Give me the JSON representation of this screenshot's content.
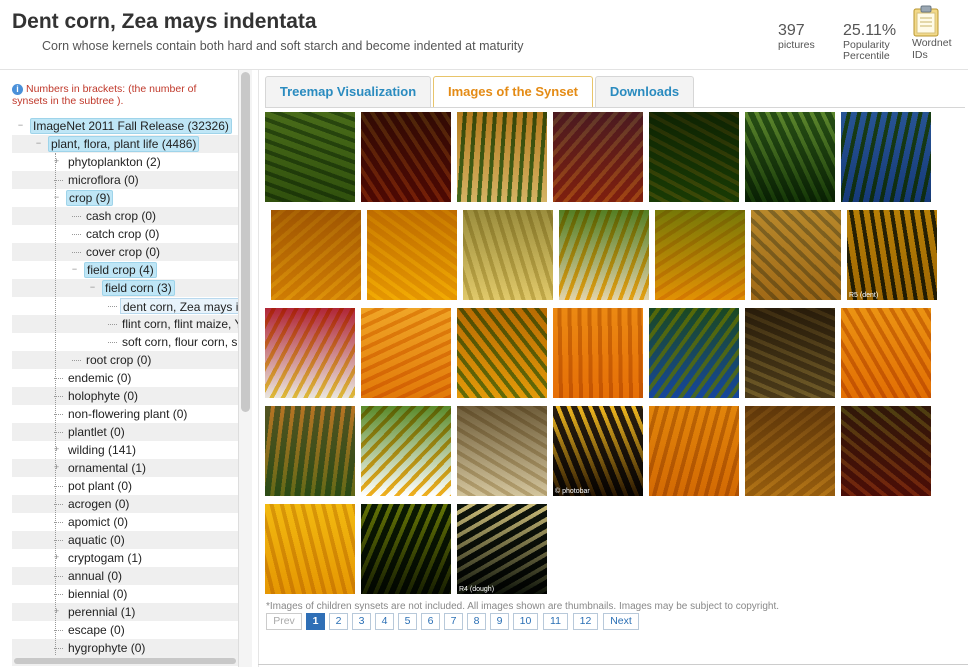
{
  "header": {
    "title": "Dent corn, Zea mays indentata",
    "subtitle": "Corn whose kernels contain both hard and soft starch and become indented at maturity",
    "pictures_count": "397",
    "pictures_label": "pictures",
    "popularity_value": "25.11%",
    "popularity_label_1": "Popularity",
    "popularity_label_2": "Percentile",
    "wordnet_label_1": "Wordnet",
    "wordnet_label_2": "IDs",
    "wordnet_icon": "clipboard-icon"
  },
  "sidebar": {
    "note": "Numbers in brackets: (the number of synsets in the subtree ).",
    "info_icon": "info-icon",
    "tree": [
      {
        "label": "ImageNet 2011 Fall Release (32326)",
        "state": "selected"
      },
      {
        "label": "plant, flora, plant life (4486)",
        "state": "selected"
      },
      {
        "label": "phytoplankton (2)",
        "state": ""
      },
      {
        "label": "microflora (0)",
        "state": ""
      },
      {
        "label": "crop (9)",
        "state": "selected"
      },
      {
        "label": "cash crop (0)",
        "state": ""
      },
      {
        "label": "catch crop (0)",
        "state": ""
      },
      {
        "label": "cover crop (0)",
        "state": ""
      },
      {
        "label": "field crop (4)",
        "state": "selected"
      },
      {
        "label": "field corn (3)",
        "state": "selected"
      },
      {
        "label": "dent corn, Zea mays i",
        "state": "current"
      },
      {
        "label": "flint corn, flint maize, Y",
        "state": ""
      },
      {
        "label": "soft corn, flour corn, s",
        "state": ""
      },
      {
        "label": "root crop (0)",
        "state": ""
      },
      {
        "label": "endemic (0)",
        "state": ""
      },
      {
        "label": "holophyte (0)",
        "state": ""
      },
      {
        "label": "non-flowering plant (0)",
        "state": ""
      },
      {
        "label": "plantlet (0)",
        "state": ""
      },
      {
        "label": "wilding (141)",
        "state": ""
      },
      {
        "label": "ornamental (1)",
        "state": ""
      },
      {
        "label": "pot plant (0)",
        "state": ""
      },
      {
        "label": "acrogen (0)",
        "state": ""
      },
      {
        "label": "apomict (0)",
        "state": ""
      },
      {
        "label": "aquatic (0)",
        "state": ""
      },
      {
        "label": "cryptogam (1)",
        "state": ""
      },
      {
        "label": "annual (0)",
        "state": ""
      },
      {
        "label": "biennial (0)",
        "state": ""
      },
      {
        "label": "perennial (1)",
        "state": ""
      },
      {
        "label": "escape (0)",
        "state": ""
      },
      {
        "label": "hygrophyte (0)",
        "state": ""
      }
    ]
  },
  "tabs": [
    {
      "label": "Treemap Visualization",
      "active": false
    },
    {
      "label": "Images of the Synset",
      "active": true
    },
    {
      "label": "Downloads",
      "active": false
    }
  ],
  "gallery": {
    "images": [
      {
        "name": "photo-corn-field-person",
        "caption": ""
      },
      {
        "name": "photo-colorful-indian-corn",
        "caption": ""
      },
      {
        "name": "photo-corn-in-hands",
        "caption": ""
      },
      {
        "name": "photo-multicolor-corn-cobs",
        "caption": ""
      },
      {
        "name": "photo-corn-on-stalk",
        "caption": ""
      },
      {
        "name": "photo-cornfield-rows",
        "caption": ""
      },
      {
        "name": "photo-corn-plants-sky",
        "caption": ""
      },
      {
        "name": "photo-yellow-kernels-closeup",
        "caption": ""
      },
      {
        "name": "photo-bright-yellow-cob",
        "caption": ""
      },
      {
        "name": "photo-husked-corn-pile",
        "caption": ""
      },
      {
        "name": "photo-white-and-yellow-cobs",
        "caption": ""
      },
      {
        "name": "photo-golden-cobs-pair",
        "caption": ""
      },
      {
        "name": "photo-cob-macro",
        "caption": ""
      },
      {
        "name": "photo-dent-stage-cob",
        "caption": "R5 (dent)"
      },
      {
        "name": "photo-corn-plate-peppers",
        "caption": ""
      },
      {
        "name": "photo-single-orange-cob",
        "caption": ""
      },
      {
        "name": "photo-cobs-in-husk",
        "caption": ""
      },
      {
        "name": "photo-stacked-cobs",
        "caption": ""
      },
      {
        "name": "photo-corn-painting-barn",
        "caption": ""
      },
      {
        "name": "photo-dried-cob-on-stalk",
        "caption": ""
      },
      {
        "name": "photo-loose-kernels",
        "caption": ""
      },
      {
        "name": "photo-two-men-eating-corn",
        "caption": ""
      },
      {
        "name": "photo-corn-illustration",
        "caption": ""
      },
      {
        "name": "photo-white-kernels",
        "caption": ""
      },
      {
        "name": "photo-cob-dark-background",
        "caption": "© photobar"
      },
      {
        "name": "photo-cobs-pile",
        "caption": ""
      },
      {
        "name": "photo-dried-cobs-heap",
        "caption": ""
      },
      {
        "name": "photo-corn-basket-dish",
        "caption": ""
      },
      {
        "name": "photo-yellow-cobs-row",
        "caption": ""
      },
      {
        "name": "photo-green-husk-cob",
        "caption": ""
      },
      {
        "name": "photo-cross-section-dough-stage",
        "caption": "R4 (dough)"
      }
    ]
  },
  "footnote": "*Images of children synsets are not included. All images shown are thumbnails. Images may be subject to copyright.",
  "pagination": {
    "prev": "Prev",
    "pages": [
      "1",
      "2",
      "3",
      "4",
      "5",
      "6",
      "7",
      "8",
      "9",
      "10",
      "11",
      "12"
    ],
    "current": "1",
    "next": "Next"
  },
  "colors": {
    "tab_active": "#e48b15",
    "tab_link": "#2a8bbf",
    "tree_selected": "#bfe6f6",
    "note_text": "#c0392b",
    "page_current": "#2f6fb6"
  }
}
